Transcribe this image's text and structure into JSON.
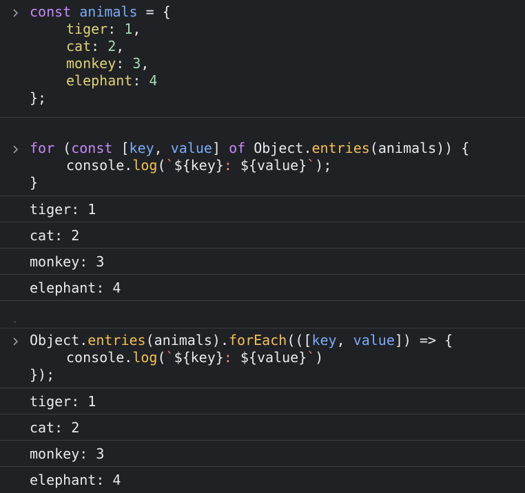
{
  "blocks": [
    {
      "lines": [
        "const animals = {",
        "tiger: 1,",
        "cat: 2,",
        "monkey: 3,",
        "elephant: 4",
        "};"
      ]
    },
    {
      "lines": [
        "for (const [key, value] of Object.entries(animals)) {",
        "console.log(`${key}: ${value}`);",
        "}"
      ],
      "output": [
        "tiger: 1",
        "cat: 2",
        "monkey: 3",
        "elephant: 4"
      ]
    },
    {
      "lines": [
        "Object.entries(animals).forEach(([key, value]) => {",
        "console.log(`${key}: ${value}`)",
        "});"
      ],
      "output": [
        "tiger: 1",
        "cat: 2",
        "monkey: 3",
        "elephant: 4"
      ]
    }
  ],
  "tokens": {
    "b1l1": [
      "const",
      "animals",
      "=",
      "{"
    ],
    "b1l2": [
      "tiger",
      ":",
      "1",
      ","
    ],
    "b1l3": [
      "cat",
      ":",
      "2",
      ","
    ],
    "b1l4": [
      "monkey",
      ":",
      "3",
      ","
    ],
    "b1l5": [
      "elephant",
      ":",
      "4"
    ],
    "b1l6": [
      "};"
    ],
    "b2l1": [
      "for",
      "(",
      "const",
      "[",
      "key",
      ",",
      "value",
      "]",
      "of",
      "Object",
      ".",
      "entries",
      "(animals)) {"
    ],
    "b2l2": [
      "console",
      ".",
      "log",
      "(",
      "`",
      "${key}",
      ":",
      "${value}",
      "`",
      ");"
    ],
    "b2l3": [
      "}"
    ],
    "b3l1": [
      "Object",
      ".",
      "entries",
      "(animals).",
      "forEach",
      "(([",
      "key",
      ",",
      "value",
      "]) => {"
    ],
    "b3l2": [
      "console",
      ".",
      "log",
      "(",
      "`",
      "${key}",
      ":",
      "${value}",
      "`",
      ")"
    ],
    "b3l3": [
      "});"
    ]
  },
  "colors": {
    "background": "#202124",
    "keyword": "#c58af9",
    "variable": "#7cacf8",
    "number": "#a8dab5",
    "function": "#f2c05c",
    "template": "#f28b82",
    "text": "#e8eaed"
  },
  "icons": {
    "prompt": "chevron-right-icon"
  }
}
